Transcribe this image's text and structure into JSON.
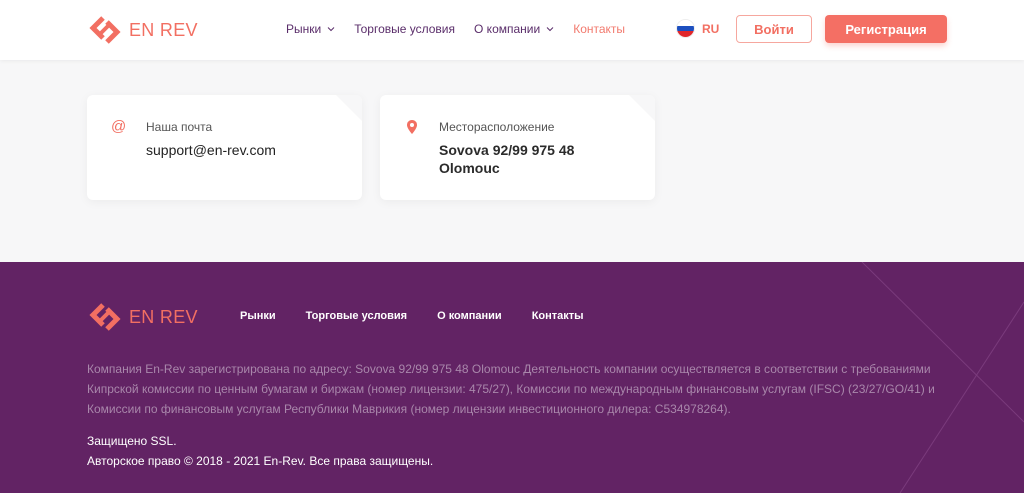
{
  "header": {
    "logo_text": "EN REV",
    "nav": [
      {
        "label": "Рынки",
        "dropdown": true,
        "active": false
      },
      {
        "label": "Торговые условия",
        "dropdown": false,
        "active": false
      },
      {
        "label": "О компании",
        "dropdown": true,
        "active": false
      },
      {
        "label": "Контакты",
        "dropdown": false,
        "active": true
      }
    ],
    "lang": "RU",
    "login_label": "Войти",
    "register_label": "Регистрация"
  },
  "contacts": {
    "email": {
      "icon": "at-icon",
      "label": "Наша почта",
      "value": "support@en-rev.com"
    },
    "location": {
      "icon": "location-pin-icon",
      "label": "Месторасположение",
      "value_line1": "Sovova 92/99 975 48",
      "value_line2": "Olomouc"
    }
  },
  "footer": {
    "logo_text": "EN REV",
    "nav": [
      "Рынки",
      "Торговые условия",
      "О компании",
      "Контакты"
    ],
    "description": "Компания En-Rev зарегистрирована по адресу: Sovova 92/99 975 48 Olomouc Деятельность компании осуществляется в соответствии с требованиями Кипрской комиссии по ценным бумагам и биржам (номер лицензии: 475/27), Комиссии по международным финансовым услугам (IFSC) (23/27/GO/41) и Комиссии по финансовым услугам Республики Маврикия (номер лицензии инвестиционного дилера: C534978264).",
    "ssl": "Защищено SSL.",
    "copyright": "Авторское право © 2018 - 2021 En-Rev. Все права защищены."
  },
  "colors": {
    "accent": "#f26f62",
    "brand_purple": "#622364",
    "nav_text": "#5a2d6a"
  }
}
